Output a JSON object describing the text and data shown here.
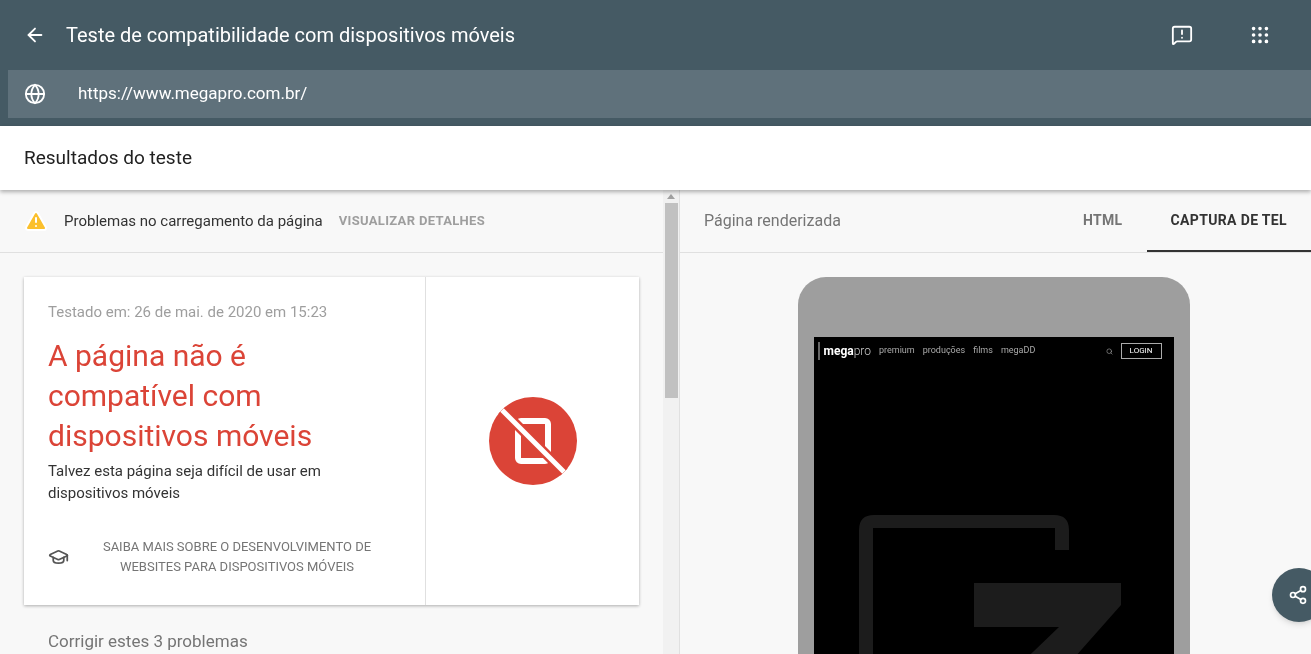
{
  "app_bar": {
    "title": "Teste de compatibilidade com dispositivos móveis"
  },
  "url_field": {
    "value": "https://www.megapro.com.br/"
  },
  "results_header": {
    "title": "Resultados do teste"
  },
  "notice": {
    "message": "Problemas no carregamento da página",
    "action": "VISUALIZAR DETALHES"
  },
  "result_card": {
    "tested_on": "Testado em: 26 de mai. de 2020 em 15:23",
    "verdict": "A página não é compatível com dispositivos móveis",
    "subtitle": "Talvez esta página seja difícil de usar em dispositivos móveis",
    "learn_more": "SAIBA MAIS SOBRE O DESENVOLVIMENTO DE WEBSITES PARA DISPOSITIVOS MÓVEIS"
  },
  "issues_heading": "Corrigir estes 3 problemas",
  "preview": {
    "label": "Página renderizada",
    "tabs": [
      {
        "label": "HTML",
        "selected": false
      },
      {
        "label": "CAPTURA DE TEL",
        "selected": true
      }
    ]
  },
  "phone_site": {
    "logo_bold": "mega",
    "logo_light": "pro",
    "nav": [
      "premium",
      "produções",
      "films",
      "megaDD"
    ],
    "login": "LOGIN"
  }
}
